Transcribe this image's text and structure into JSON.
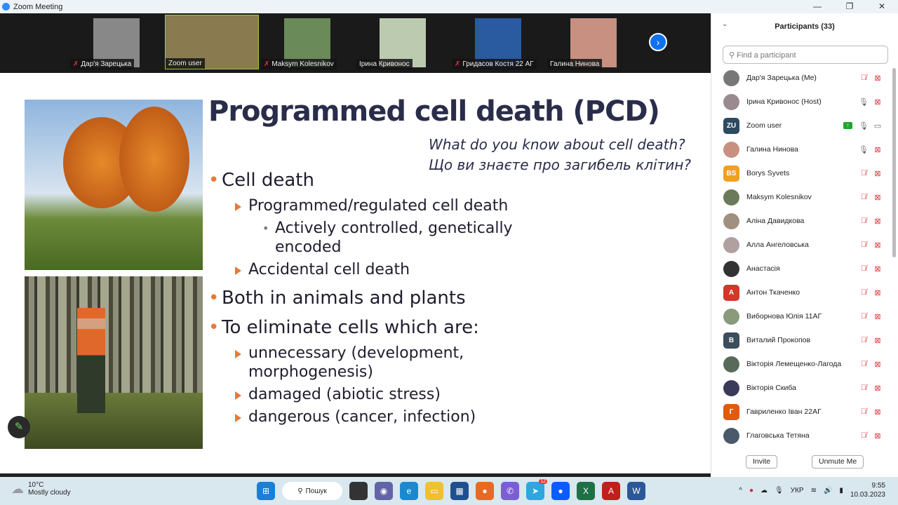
{
  "window": {
    "title": "Zoom Meeting",
    "controls": [
      "—",
      "❐",
      "✕"
    ]
  },
  "video_strip": [
    {
      "name": "Дар'я Зарецька",
      "muted": true,
      "color": "#888"
    },
    {
      "name": "Zoom user",
      "muted": false,
      "color": "#8a7a50"
    },
    {
      "name": "Maksym Kolesnikov",
      "muted": true,
      "color": "#6a8a5a"
    },
    {
      "name": "Ірина Кривонос",
      "muted": false,
      "color": "#bccbb0"
    },
    {
      "name": "Гридасов Костя 22 АГ",
      "muted": true,
      "color": "#2a5aa0"
    },
    {
      "name": "Галина Нинова",
      "muted": false,
      "color": "#c89080"
    }
  ],
  "slide": {
    "title": "Programmed cell death (PCD)",
    "questions": [
      "What do you know about cell death?",
      "Що ви знаєте про загибель клітин?"
    ],
    "bullets": [
      {
        "level": 1,
        "text": "Cell death"
      },
      {
        "level": 2,
        "text": "Programmed/regulated cell death"
      },
      {
        "level": 3,
        "text": "Actively controlled, genetically"
      },
      {
        "level": 3,
        "text": "encoded",
        "cont": true
      },
      {
        "level": 2,
        "text": "Accidental cell death"
      },
      {
        "level": 1,
        "text": "Both in animals and plants"
      },
      {
        "level": 1,
        "text": "To eliminate cells which are:"
      },
      {
        "level": 2,
        "text": "unnecessary (development,"
      },
      {
        "level": 2,
        "text": "morphogenesis)",
        "cont": true
      },
      {
        "level": 2,
        "text": "damaged (abiotic stress)"
      },
      {
        "level": 2,
        "text": "dangerous (cancer, infection)"
      }
    ]
  },
  "participants": {
    "title": "Participants (33)",
    "search_placeholder": "Find a participant",
    "list": [
      {
        "name": "Дар'я Зарецька (Me)",
        "avatar": "",
        "color": "#777",
        "mic": "muted",
        "video": "off"
      },
      {
        "name": "Ірина Кривонос (Host)",
        "avatar": "",
        "color": "#9a8a90",
        "mic": "on",
        "video": "off"
      },
      {
        "name": "Zoom user",
        "avatar": "ZU",
        "color": "#2d4a5e",
        "mic": "on",
        "video": "on",
        "sharing": true
      },
      {
        "name": "Галина Нинова",
        "avatar": "",
        "color": "#c89080",
        "mic": "on",
        "video": "off"
      },
      {
        "name": "Borys Syvets",
        "avatar": "BS",
        "color": "#f0a020",
        "mic": "muted",
        "video": "off"
      },
      {
        "name": "Maksym Kolesnikov",
        "avatar": "",
        "color": "#6a7a5a",
        "mic": "muted",
        "video": "off"
      },
      {
        "name": "Аліна Давидкова",
        "avatar": "",
        "color": "#a09080",
        "mic": "muted",
        "video": "off"
      },
      {
        "name": "Алла Ангеловська",
        "avatar": "",
        "color": "#b0a0a0",
        "mic": "muted",
        "video": "off"
      },
      {
        "name": "Анастасія",
        "avatar": "",
        "color": "#333",
        "mic": "muted",
        "video": "off"
      },
      {
        "name": "Антон Ткаченко",
        "avatar": "A",
        "color": "#d0392b",
        "mic": "muted",
        "video": "off"
      },
      {
        "name": "Виборнова Юлія 11АГ",
        "avatar": "",
        "color": "#8a9a7a",
        "mic": "muted",
        "video": "off"
      },
      {
        "name": "Виталий Прокопов",
        "avatar": "В",
        "color": "#3c4d5c",
        "mic": "muted",
        "video": "off"
      },
      {
        "name": "Вікторія Лемещенко-Лагода",
        "avatar": "",
        "color": "#5a6a5a",
        "mic": "muted",
        "video": "off"
      },
      {
        "name": "Вікторія Скиба",
        "avatar": "",
        "color": "#3a3a5a",
        "mic": "muted",
        "video": "off"
      },
      {
        "name": "Гавриленко Іван 22АГ",
        "avatar": "Г",
        "color": "#e05a10",
        "mic": "muted",
        "video": "off"
      },
      {
        "name": "Глаговська Тетяна",
        "avatar": "",
        "color": "#4a5a6a",
        "mic": "muted",
        "video": "off"
      }
    ],
    "invite_label": "Invite",
    "unmute_label": "Unmute Me"
  },
  "taskbar": {
    "temp": "10°C",
    "weather": "Mostly cloudy",
    "search_label": "Пошук",
    "telegram_badge": "12",
    "language": "УКР",
    "time": "9:55",
    "date": "10.03.2023"
  }
}
